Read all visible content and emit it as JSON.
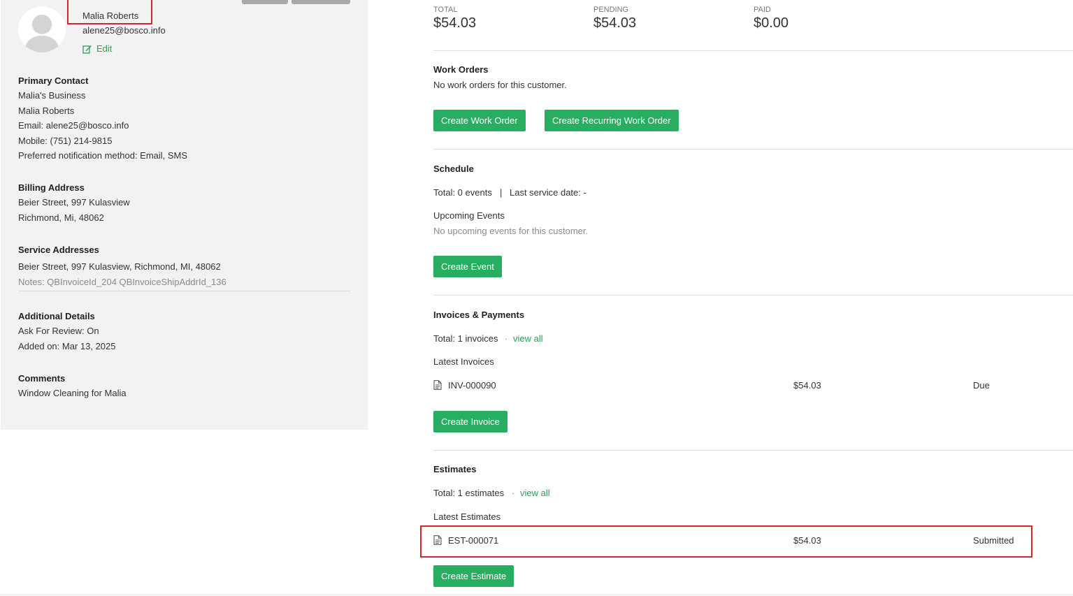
{
  "customer": {
    "name": "Malia Roberts",
    "email": "alene25@bosco.info",
    "edit_label": "Edit"
  },
  "primary_contact": {
    "heading": "Primary Contact",
    "business": "Malia's Business",
    "name": "Malia Roberts",
    "email": "Email: alene25@bosco.info",
    "mobile": "Mobile: (751) 214-9815",
    "notification": "Preferred notification method: Email, SMS"
  },
  "billing_address": {
    "heading": "Billing Address",
    "line1": "Beier Street, 997 Kulasview",
    "line2": "Richmond, Mi, 48062"
  },
  "service_addresses": {
    "heading": "Service Addresses",
    "address": "Beier Street, 997 Kulasview, Richmond, MI, 48062",
    "notes": "Notes: QBInvoiceId_204 QBInvoiceShipAddrId_136"
  },
  "additional_details": {
    "heading": "Additional Details",
    "review": "Ask For Review: On",
    "added": "Added on: Mar 13, 2025"
  },
  "comments": {
    "heading": "Comments",
    "text": "Window Cleaning for Malia"
  },
  "stats": {
    "total_label": "TOTAL",
    "total_value": "$54.03",
    "pending_label": "PENDING",
    "pending_value": "$54.03",
    "paid_label": "PAID",
    "paid_value": "$0.00"
  },
  "work_orders": {
    "title": "Work Orders",
    "empty": "No work orders for this customer.",
    "create_label": "Create Work Order",
    "create_recurring_label": "Create Recurring Work Order"
  },
  "schedule": {
    "title": "Schedule",
    "total": "Total: 0 events",
    "separator": "|",
    "last_service": "Last service date: -",
    "upcoming_title": "Upcoming Events",
    "upcoming_empty": "No upcoming events for this customer.",
    "create_label": "Create Event"
  },
  "invoices": {
    "title": "Invoices & Payments",
    "total": "Total: 1 invoices",
    "dot": "·",
    "view_all": "view all",
    "latest_title": "Latest Invoices",
    "items": [
      {
        "id": "INV-000090",
        "amount": "$54.03",
        "status": "Due"
      }
    ],
    "create_label": "Create Invoice"
  },
  "estimates": {
    "title": "Estimates",
    "total": "Total: 1 estimates",
    "dot": "·",
    "view_all": "view all",
    "latest_title": "Latest Estimates",
    "items": [
      {
        "id": "EST-000071",
        "amount": "$54.03",
        "status": "Submitted"
      }
    ],
    "create_label": "Create Estimate"
  },
  "colors": {
    "accent_green": "#27ae60",
    "link_green": "#2e9e52",
    "highlight_red": "#d9262c",
    "panel_bg": "#f2f2f2"
  },
  "icons": {
    "avatar": "user-avatar-icon",
    "edit": "edit-icon",
    "document": "document-icon"
  }
}
